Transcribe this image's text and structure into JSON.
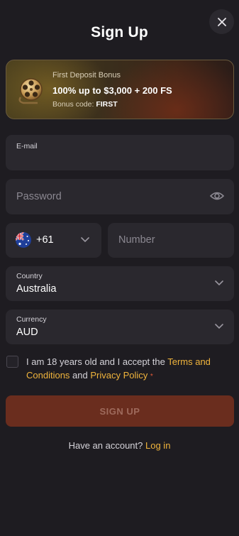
{
  "header": {
    "title": "Sign Up",
    "close_icon": "close-icon"
  },
  "bonus": {
    "subtitle": "First Deposit Bonus",
    "headline": "100% up to $3,000 + 200 FS",
    "code_label": "Bonus code:",
    "code_value": "FIRST",
    "icon": "film-reel-icon"
  },
  "form": {
    "email": {
      "label": "E-mail",
      "value": ""
    },
    "password": {
      "placeholder": "Password",
      "icon": "eye-icon"
    },
    "phone": {
      "country_flag": "australia-flag-icon",
      "dial_code": "+61",
      "number_placeholder": "Number"
    },
    "country": {
      "label": "Country",
      "value": "Australia"
    },
    "currency": {
      "label": "Currency",
      "value": "AUD"
    },
    "consent": {
      "checked": false,
      "text_before": "I am 18 years old and I accept the ",
      "terms_link": "Terms and Conditions",
      "text_middle": " and ",
      "privacy_link": "Privacy Policy",
      "required_mark": "*"
    },
    "submit_label": "SIGN UP"
  },
  "footer": {
    "prompt": "Have an account?",
    "login_link": "Log in"
  },
  "colors": {
    "background": "#1e1c21",
    "field": "#2a282e",
    "accent_link": "#f0b43c",
    "button_disabled": "#6a2d1e"
  }
}
